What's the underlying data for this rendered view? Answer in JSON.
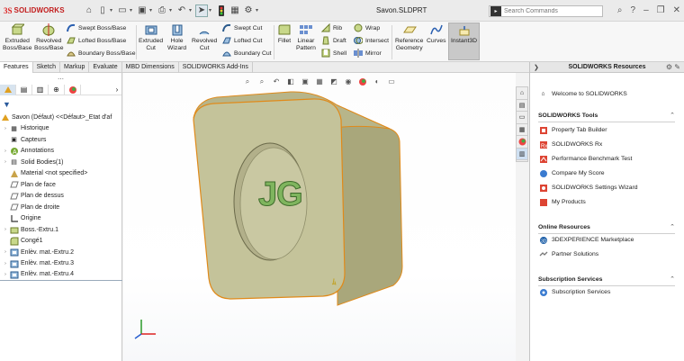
{
  "app": {
    "brand_prefix": "3S",
    "brand_name": "SOLIDWORKS",
    "document_title": "Savon.SLDPRT"
  },
  "search": {
    "placeholder": "Search Commands"
  },
  "ribbon": {
    "extruded_boss": "Extruded\nBoss/Base",
    "revolved_boss": "Revolved\nBoss/Base",
    "swept_boss": "Swept Boss/Base",
    "lofted_boss": "Lofted Boss/Base",
    "boundary_boss": "Boundary Boss/Base",
    "extruded_cut": "Extruded\nCut",
    "hole_wizard": "Hole\nWizard",
    "revolved_cut": "Revolved\nCut",
    "swept_cut": "Swept Cut",
    "lofted_cut": "Lofted Cut",
    "boundary_cut": "Boundary Cut",
    "fillet": "Fillet",
    "linear_pattern": "Linear\nPattern",
    "rib": "Rib",
    "draft": "Draft",
    "shell": "Shell",
    "wrap": "Wrap",
    "intersect": "Intersect",
    "mirror": "Mirror",
    "reference_geometry": "Reference\nGeometry",
    "curves": "Curves",
    "instant3d": "Instant3D"
  },
  "tabs": [
    "Features",
    "Sketch",
    "Markup",
    "Evaluate",
    "MBD Dimensions",
    "SOLIDWORKS Add-Ins"
  ],
  "tree": {
    "root": "Savon (Défaut) <<Défaut>_Etat d'af",
    "items": [
      "Historique",
      "Capteurs",
      "Annotations",
      "Solid Bodies(1)",
      "Material <not specified>",
      "Plan de face",
      "Plan de dessus",
      "Plan de droite",
      "Origine",
      "Boss.-Extru.1",
      "Congé1",
      "Enlèv. mat.-Extru.2",
      "Enlèv. mat.-Extru.3",
      "Enlèv. mat.-Extru.4"
    ]
  },
  "model": {
    "emboss_text": "JG"
  },
  "resources": {
    "title": "SOLIDWORKS Resources",
    "welcome": "Welcome to SOLIDWORKS",
    "tools_header": "SOLIDWORKS Tools",
    "tools": [
      "Property Tab Builder",
      "SOLIDWORKS Rx",
      "Performance Benchmark Test",
      "Compare My Score",
      "SOLIDWORKS Settings Wizard",
      "My Products"
    ],
    "online_header": "Online Resources",
    "online": [
      "3DEXPERIENCE Marketplace",
      "Partner Solutions"
    ],
    "subscription_header": "Subscription Services",
    "subscription": [
      "Subscription Services"
    ]
  },
  "colors": {
    "part_body": "#c4c39a",
    "part_edge": "#e08a1a",
    "brand_red": "#c21c1c",
    "emboss_green": "#6aa84f"
  }
}
